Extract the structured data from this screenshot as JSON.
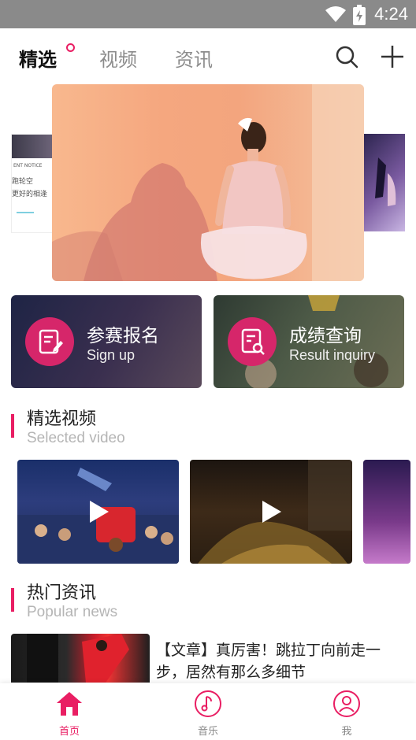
{
  "status": {
    "time": "4:24",
    "icons": [
      "wifi-icon",
      "battery-charging-icon"
    ]
  },
  "topnav": {
    "tabs": [
      {
        "label": "精选",
        "active": true
      },
      {
        "label": "视频",
        "active": false
      },
      {
        "label": "资讯",
        "active": false
      }
    ],
    "actions": [
      "search-icon",
      "add-icon"
    ]
  },
  "banner": {
    "left_preview": {
      "line1": "ENT NOTICE",
      "line2": "跑轮空",
      "line3": "更好的相逢"
    }
  },
  "cards": [
    {
      "title": "参赛报名",
      "subtitle": "Sign up",
      "icon": "edit-form-icon"
    },
    {
      "title": "成绩查询",
      "subtitle": "Result inquiry",
      "icon": "search-document-icon"
    }
  ],
  "sections": {
    "videos": {
      "title": "精选视频",
      "subtitle": "Selected video"
    },
    "news": {
      "title": "热门资讯",
      "subtitle": "Popular news"
    }
  },
  "news": [
    {
      "title": "【文章】真厉害！跳拉丁向前走一步，居然有那么多细节"
    }
  ],
  "bottomnav": [
    {
      "label": "首页",
      "icon": "home-icon",
      "active": true
    },
    {
      "label": "音乐",
      "icon": "music-note-icon",
      "active": false
    },
    {
      "label": "我",
      "icon": "user-icon",
      "active": false
    }
  ],
  "colors": {
    "accent": "#e91e63",
    "statusbar": "#8a8a8a"
  }
}
